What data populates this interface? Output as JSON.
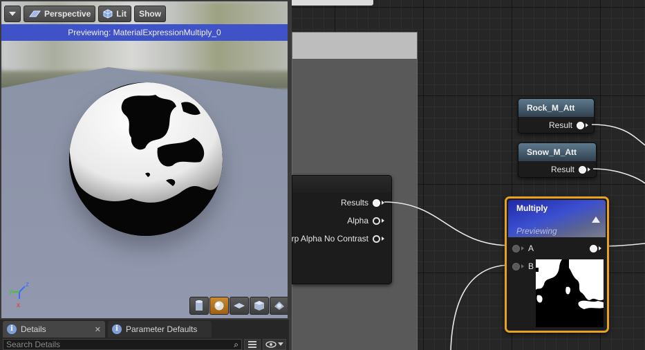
{
  "viewport": {
    "toolbar": {
      "menu_icon": "chevron-down-icon",
      "perspective_label": "Perspective",
      "lit_label": "Lit",
      "show_label": "Show"
    },
    "preview_banner": "Previewing: MaterialExpressionMultiply_0",
    "axis": {
      "x": "x",
      "y": "y",
      "z": "z"
    },
    "preview_shapes": [
      "cylinder-icon",
      "sphere-icon",
      "plane-icon",
      "cube-icon",
      "custom-mesh-icon"
    ],
    "active_shape": "sphere-icon"
  },
  "bottom_panel": {
    "tabs": [
      {
        "label": "Details",
        "icon": "info-icon"
      },
      {
        "label": "Parameter Defaults",
        "icon": "info-icon"
      }
    ],
    "search": {
      "placeholder": "Search Details"
    }
  },
  "graph": {
    "nodes": {
      "rock": {
        "title": "Rock_M_Att",
        "output": "Result"
      },
      "snow": {
        "title": "Snow_M_Att",
        "output": "Result"
      },
      "partial": {
        "outputs": [
          "Results",
          "Alpha",
          "rp Alpha No Contrast"
        ]
      },
      "multiply": {
        "title": "Multiply",
        "subtitle": "Previewing",
        "inputs": [
          "A",
          "B"
        ]
      }
    }
  },
  "colors": {
    "preview_banner": "#3f52c7",
    "selection_outline": "#e8a220",
    "node_header": "#4a6478",
    "multiply_header": "#2f3fc4"
  }
}
